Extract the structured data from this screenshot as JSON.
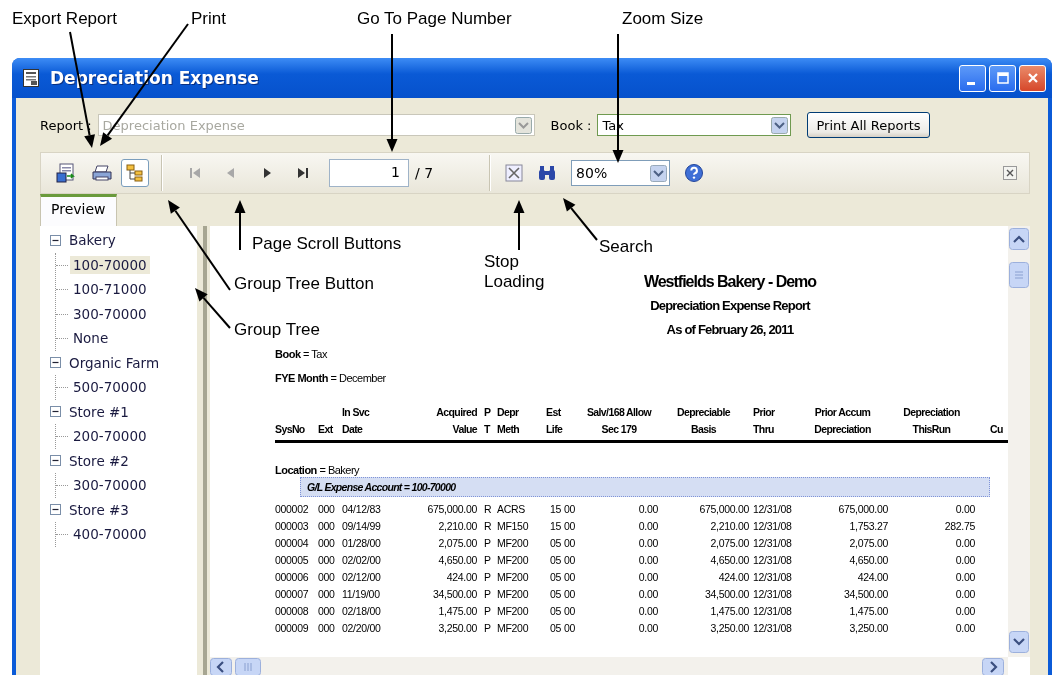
{
  "callouts": [
    {
      "text": "Export Report"
    },
    {
      "text": "Print"
    },
    {
      "text": "Go To Page Number"
    },
    {
      "text": "Zoom Size"
    },
    {
      "text": "Page Scroll Buttons"
    },
    {
      "text": "Stop Loading"
    },
    {
      "text": "Search"
    },
    {
      "text": "Group Tree Button"
    },
    {
      "text": "Group Tree"
    }
  ],
  "window": {
    "title": "Depreciation Expense"
  },
  "report_bar": {
    "report_label": "Report :",
    "report_combo": {
      "value": "Depreciation Expense",
      "disabled": true
    },
    "book_label": "Book :",
    "book_combo": {
      "value": "Tax",
      "disabled": false
    },
    "print_all_button": "Print All Reports"
  },
  "toolbar": {
    "group_tree_button": {
      "selected": true
    },
    "nav_buttons": [
      {
        "kind": "first",
        "disabled": true
      },
      {
        "kind": "previous",
        "disabled": true
      },
      {
        "kind": "next",
        "disabled": false
      },
      {
        "kind": "last",
        "disabled": false
      }
    ],
    "page_field": {
      "value": "1"
    },
    "page_count": "/ 7",
    "zoom_combo": {
      "value": "80%"
    }
  },
  "tabs": [
    {
      "label": "Preview",
      "selected": true
    }
  ],
  "group_tree": [
    {
      "label": "Bakery",
      "expanded": true,
      "selected": false,
      "children": [
        {
          "label": "100-70000",
          "selected": true
        },
        {
          "label": "100-71000",
          "selected": false
        },
        {
          "label": "300-70000",
          "selected": false
        },
        {
          "label": "None",
          "selected": false
        }
      ]
    },
    {
      "label": "Organic Farm",
      "expanded": true,
      "selected": false,
      "children": [
        {
          "label": "500-70000",
          "selected": false
        }
      ]
    },
    {
      "label": "Store #1",
      "expanded": true,
      "selected": false,
      "children": [
        {
          "label": "200-70000",
          "selected": false
        }
      ]
    },
    {
      "label": "Store #2",
      "expanded": true,
      "selected": false,
      "children": [
        {
          "label": "300-70000",
          "selected": false
        }
      ]
    },
    {
      "label": "Store #3",
      "expanded": true,
      "selected": false,
      "children": [
        {
          "label": "400-70000",
          "selected": false
        }
      ]
    }
  ],
  "report": {
    "title": "Westfields Bakery - Demo",
    "subtitle": "Depreciation Expense Report",
    "date_line": "As of February 26, 2011",
    "params": [
      "**Book** = Tax",
      "**FYE Month** = December"
    ],
    "columns": [
      {
        "lines": [
          "SysNo"
        ]
      },
      {
        "lines": [
          "Ext"
        ]
      },
      {
        "lines": [
          "In Svc",
          "Date"
        ]
      },
      {
        "lines": [
          "Acquired",
          "Value"
        ]
      },
      {
        "lines": [
          "P",
          "T"
        ]
      },
      {
        "lines": [
          "Depr",
          "Meth"
        ]
      },
      {
        "lines": [
          "Est",
          "Life"
        ]
      },
      {},
      {
        "lines": [
          "Salv/168 Allow",
          "Sec 179"
        ]
      },
      {
        "lines": [
          "Depreciable",
          "Basis"
        ]
      },
      {
        "lines": [
          "Prior",
          "Thru"
        ]
      },
      {
        "lines": [
          "Prior Accum",
          "Depreciation"
        ]
      },
      {
        "lines": [
          "Depreciation",
          "ThisRun"
        ]
      },
      {
        "lines": [
          "Cu"
        ]
      }
    ],
    "group_label": "**Location** = Bakery",
    "band": "G/L Expense Account = 100-70000",
    "rows": [
      {
        "cells": [
          "000002",
          "000",
          "04/12/83",
          "675,000.00",
          "R",
          "ACRS",
          "15",
          "00",
          "0.00",
          "675,000.00",
          "12/31/08",
          "675,000.00",
          "0.00"
        ]
      },
      {
        "cells": [
          "000003",
          "000",
          "09/14/99",
          "2,210.00",
          "R",
          "MF150",
          "15",
          "00",
          "0.00",
          "2,210.00",
          "12/31/08",
          "1,753.27",
          "282.75"
        ]
      },
      {
        "cells": [
          "000004",
          "000",
          "01/28/00",
          "2,075.00",
          "P",
          "MF200",
          "05",
          "00",
          "0.00",
          "2,075.00",
          "12/31/08",
          "2,075.00",
          "0.00"
        ]
      },
      {
        "cells": [
          "000005",
          "000",
          "02/02/00",
          "4,650.00",
          "P",
          "MF200",
          "05",
          "00",
          "0.00",
          "4,650.00",
          "12/31/08",
          "4,650.00",
          "0.00"
        ]
      },
      {
        "cells": [
          "000006",
          "000",
          "02/12/00",
          "424.00",
          "P",
          "MF200",
          "05",
          "00",
          "0.00",
          "424.00",
          "12/31/08",
          "424.00",
          "0.00"
        ]
      },
      {
        "cells": [
          "000007",
          "000",
          "11/19/00",
          "34,500.00",
          "P",
          "MF200",
          "05",
          "00",
          "0.00",
          "34,500.00",
          "12/31/08",
          "34,500.00",
          "0.00"
        ]
      },
      {
        "cells": [
          "000008",
          "000",
          "02/18/00",
          "1,475.00",
          "P",
          "MF200",
          "05",
          "00",
          "0.00",
          "1,475.00",
          "12/31/08",
          "1,475.00",
          "0.00"
        ]
      },
      {
        "cells": [
          "000009",
          "000",
          "02/20/00",
          "3,250.00",
          "P",
          "MF200",
          "05",
          "00",
          "0.00",
          "3,250.00",
          "12/31/08",
          "3,250.00",
          "0.00"
        ]
      }
    ]
  }
}
